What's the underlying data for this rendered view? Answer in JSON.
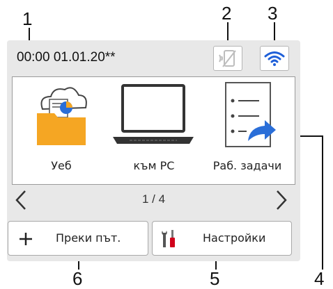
{
  "callouts": [
    "1",
    "2",
    "3",
    "4",
    "5",
    "6"
  ],
  "status_bar": {
    "datetime": "00:00  01.01.20**",
    "nfc_icon": "nfc-disabled-icon",
    "wifi_icon": "wifi-icon"
  },
  "apps": [
    {
      "label": "Уеб",
      "icon": "web-cloud-folder-icon"
    },
    {
      "label": "към PC",
      "icon": "laptop-icon"
    },
    {
      "label": "Раб. задачи",
      "icon": "workflow-list-icon"
    }
  ],
  "pager": {
    "text": "1 / 4",
    "prev_icon": "chevron-left-icon",
    "next_icon": "chevron-right-icon"
  },
  "buttons": {
    "shortcuts_label": "Преки път.",
    "settings_label": "Настройки"
  },
  "colors": {
    "screen_bg": "#e8e8e8",
    "folder": "#f5a623",
    "wifi": "#1e5fd8",
    "arrow_blue": "#2a6ed8",
    "pie_blue": "#2a6ed8",
    "pie_orange": "#f5a623",
    "tool_red": "#d0021b"
  }
}
